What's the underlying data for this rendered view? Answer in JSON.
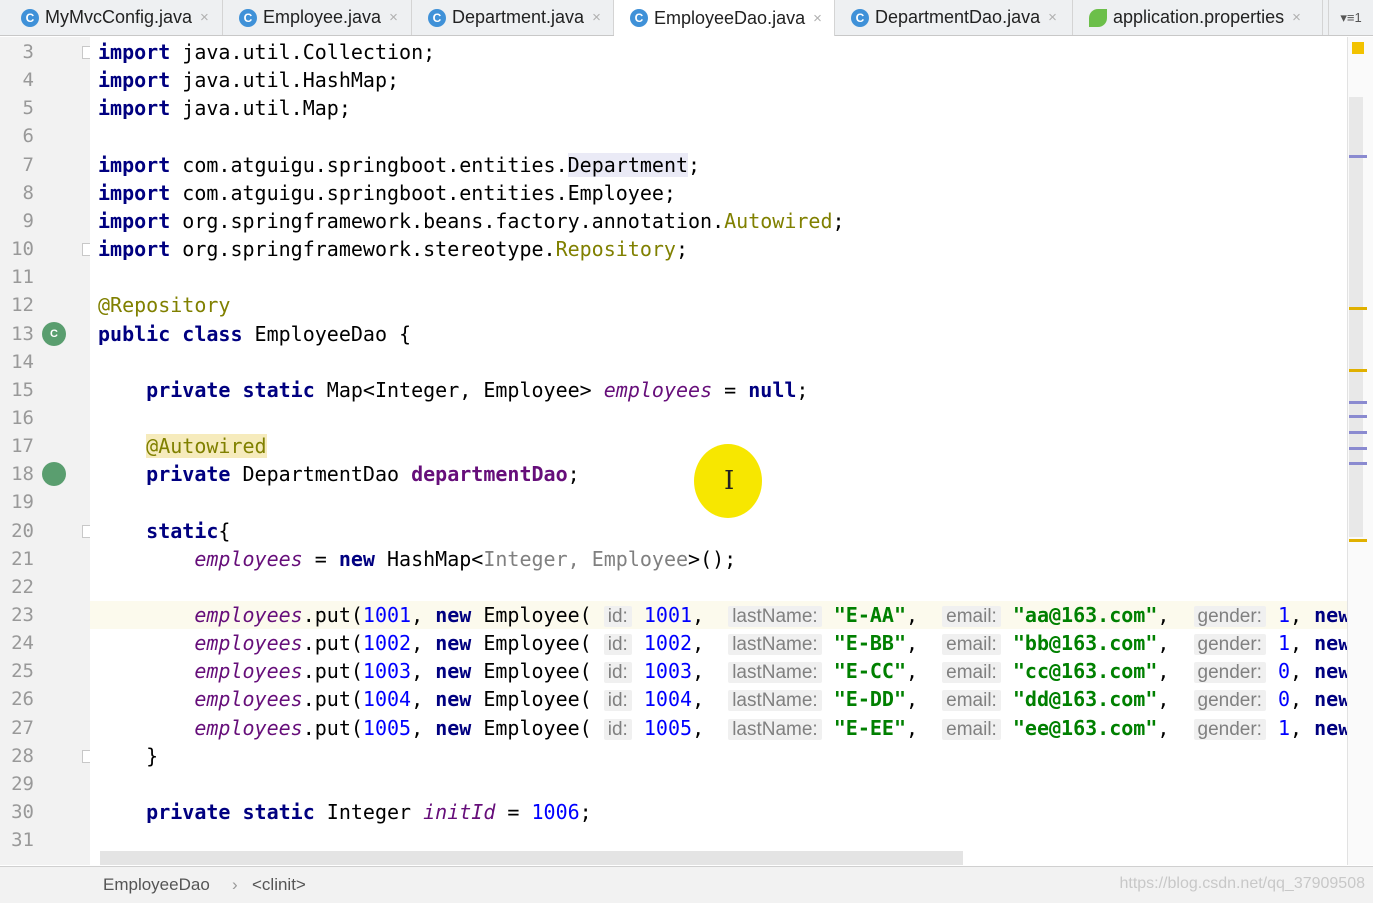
{
  "tabs": [
    {
      "label": "MyMvcConfig.java",
      "icon": "C",
      "active": false
    },
    {
      "label": "Employee.java",
      "icon": "C",
      "active": false
    },
    {
      "label": "Department.java",
      "icon": "C",
      "active": false
    },
    {
      "label": "EmployeeDao.java",
      "icon": "C",
      "active": true
    },
    {
      "label": "DepartmentDao.java",
      "icon": "C",
      "active": false
    },
    {
      "label": "application.properties",
      "icon": "leaf",
      "active": false
    }
  ],
  "tab_overflow": "▾≡1",
  "close_glyph": "×",
  "lines": [
    {
      "n": "3",
      "t": [
        [
          "kw",
          "import"
        ],
        [
          "",
          " java.util.Collection;"
        ]
      ]
    },
    {
      "n": "4",
      "t": [
        [
          "kw",
          "import"
        ],
        [
          "",
          " java.util.HashMap;"
        ]
      ]
    },
    {
      "n": "5",
      "t": [
        [
          "kw",
          "import"
        ],
        [
          "",
          " java.util.Map;"
        ]
      ]
    },
    {
      "n": "6",
      "t": []
    },
    {
      "n": "7",
      "t": [
        [
          "kw",
          "import"
        ],
        [
          "",
          " com.atguigu.springboot.entities."
        ],
        [
          "hl-type",
          "Department"
        ],
        [
          "",
          ";"
        ]
      ]
    },
    {
      "n": "8",
      "t": [
        [
          "kw",
          "import"
        ],
        [
          "",
          " com.atguigu.springboot.entities.Employee;"
        ]
      ]
    },
    {
      "n": "9",
      "t": [
        [
          "kw",
          "import"
        ],
        [
          "",
          " org.springframework.beans.factory.annotation."
        ],
        [
          "ann",
          "Autowired"
        ],
        [
          "",
          ";"
        ]
      ]
    },
    {
      "n": "10",
      "t": [
        [
          "kw",
          "import"
        ],
        [
          "",
          " org.springframework.stereotype."
        ],
        [
          "ann",
          "Repository"
        ],
        [
          "",
          ";"
        ]
      ]
    },
    {
      "n": "11",
      "t": []
    },
    {
      "n": "12",
      "t": [
        [
          "ann",
          "@Repository"
        ]
      ]
    },
    {
      "n": "13",
      "t": [
        [
          "kw",
          "public class"
        ],
        [
          "",
          " EmployeeDao {"
        ]
      ]
    },
    {
      "n": "14",
      "t": []
    },
    {
      "n": "15",
      "t": [
        [
          "",
          "    "
        ],
        [
          "kw",
          "private static"
        ],
        [
          "",
          " Map<Integer, Employee> "
        ],
        [
          "ital",
          "employees"
        ],
        [
          "",
          " = "
        ],
        [
          "kw",
          "null"
        ],
        [
          "",
          ";"
        ]
      ]
    },
    {
      "n": "16",
      "t": []
    },
    {
      "n": "17",
      "t": [
        [
          "",
          "    "
        ],
        [
          "ann hl-ann",
          "@Autowired"
        ]
      ]
    },
    {
      "n": "18",
      "t": [
        [
          "",
          "    "
        ],
        [
          "kw",
          "private"
        ],
        [
          "",
          " DepartmentDao "
        ],
        [
          "fld",
          "departmentDao"
        ],
        [
          "",
          ";"
        ]
      ]
    },
    {
      "n": "19",
      "t": []
    },
    {
      "n": "20",
      "t": [
        [
          "",
          "    "
        ],
        [
          "kw",
          "static"
        ],
        [
          "",
          "{"
        ]
      ]
    },
    {
      "n": "21",
      "t": [
        [
          "",
          "        "
        ],
        [
          "ital",
          "employees"
        ],
        [
          "",
          " = "
        ],
        [
          "kw",
          "new"
        ],
        [
          "",
          " HashMap<"
        ],
        [
          "gen",
          "Integer, Employee"
        ],
        [
          "",
          ">();"
        ]
      ]
    },
    {
      "n": "22",
      "t": []
    },
    {
      "n": "23",
      "t": [
        [
          "",
          "        "
        ],
        [
          "ital",
          "employees"
        ],
        [
          "",
          ".put("
        ],
        [
          "num",
          "1001"
        ],
        [
          "",
          ", "
        ],
        [
          "kw",
          "new"
        ],
        [
          "",
          " Employee( "
        ],
        [
          "hint",
          "id:"
        ],
        [
          "",
          " "
        ],
        [
          "num",
          "1001"
        ],
        [
          "",
          ",  "
        ],
        [
          "hint",
          "lastName:"
        ],
        [
          "",
          " "
        ],
        [
          "str",
          "\"E-AA\""
        ],
        [
          "",
          ",  "
        ],
        [
          "hint",
          "email:"
        ],
        [
          "",
          " "
        ],
        [
          "str",
          "\"aa@163.com\""
        ],
        [
          "",
          ",  "
        ],
        [
          "hint",
          "gender:"
        ],
        [
          "",
          " "
        ],
        [
          "num",
          "1"
        ],
        [
          "",
          ", "
        ],
        [
          "kw",
          "new"
        ]
      ]
    },
    {
      "n": "24",
      "t": [
        [
          "",
          "        "
        ],
        [
          "ital",
          "employees"
        ],
        [
          "",
          ".put("
        ],
        [
          "num",
          "1002"
        ],
        [
          "",
          ", "
        ],
        [
          "kw",
          "new"
        ],
        [
          "",
          " Employee( "
        ],
        [
          "hint",
          "id:"
        ],
        [
          "",
          " "
        ],
        [
          "num",
          "1002"
        ],
        [
          "",
          ",  "
        ],
        [
          "hint",
          "lastName:"
        ],
        [
          "",
          " "
        ],
        [
          "str",
          "\"E-BB\""
        ],
        [
          "",
          ",  "
        ],
        [
          "hint",
          "email:"
        ],
        [
          "",
          " "
        ],
        [
          "str",
          "\"bb@163.com\""
        ],
        [
          "",
          ",  "
        ],
        [
          "hint",
          "gender:"
        ],
        [
          "",
          " "
        ],
        [
          "num",
          "1"
        ],
        [
          "",
          ", "
        ],
        [
          "kw",
          "new"
        ]
      ]
    },
    {
      "n": "25",
      "t": [
        [
          "",
          "        "
        ],
        [
          "ital",
          "employees"
        ],
        [
          "",
          ".put("
        ],
        [
          "num",
          "1003"
        ],
        [
          "",
          ", "
        ],
        [
          "kw",
          "new"
        ],
        [
          "",
          " Employee( "
        ],
        [
          "hint",
          "id:"
        ],
        [
          "",
          " "
        ],
        [
          "num",
          "1003"
        ],
        [
          "",
          ",  "
        ],
        [
          "hint",
          "lastName:"
        ],
        [
          "",
          " "
        ],
        [
          "str",
          "\"E-CC\""
        ],
        [
          "",
          ",  "
        ],
        [
          "hint",
          "email:"
        ],
        [
          "",
          " "
        ],
        [
          "str",
          "\"cc@163.com\""
        ],
        [
          "",
          ",  "
        ],
        [
          "hint",
          "gender:"
        ],
        [
          "",
          " "
        ],
        [
          "num",
          "0"
        ],
        [
          "",
          ", "
        ],
        [
          "kw",
          "new"
        ]
      ]
    },
    {
      "n": "26",
      "t": [
        [
          "",
          "        "
        ],
        [
          "ital",
          "employees"
        ],
        [
          "",
          ".put("
        ],
        [
          "num",
          "1004"
        ],
        [
          "",
          ", "
        ],
        [
          "kw",
          "new"
        ],
        [
          "",
          " Employee( "
        ],
        [
          "hint",
          "id:"
        ],
        [
          "",
          " "
        ],
        [
          "num",
          "1004"
        ],
        [
          "",
          ",  "
        ],
        [
          "hint",
          "lastName:"
        ],
        [
          "",
          " "
        ],
        [
          "str",
          "\"E-DD\""
        ],
        [
          "",
          ",  "
        ],
        [
          "hint",
          "email:"
        ],
        [
          "",
          " "
        ],
        [
          "str",
          "\"dd@163.com\""
        ],
        [
          "",
          ",  "
        ],
        [
          "hint",
          "gender:"
        ],
        [
          "",
          " "
        ],
        [
          "num",
          "0"
        ],
        [
          "",
          ", "
        ],
        [
          "kw",
          "new"
        ]
      ]
    },
    {
      "n": "27",
      "t": [
        [
          "",
          "        "
        ],
        [
          "ital",
          "employees"
        ],
        [
          "",
          ".put("
        ],
        [
          "num",
          "1005"
        ],
        [
          "",
          ", "
        ],
        [
          "kw",
          "new"
        ],
        [
          "",
          " Employee( "
        ],
        [
          "hint",
          "id:"
        ],
        [
          "",
          " "
        ],
        [
          "num",
          "1005"
        ],
        [
          "",
          ",  "
        ],
        [
          "hint",
          "lastName:"
        ],
        [
          "",
          " "
        ],
        [
          "str",
          "\"E-EE\""
        ],
        [
          "",
          ",  "
        ],
        [
          "hint",
          "email:"
        ],
        [
          "",
          " "
        ],
        [
          "str",
          "\"ee@163.com\""
        ],
        [
          "",
          ",  "
        ],
        [
          "hint",
          "gender:"
        ],
        [
          "",
          " "
        ],
        [
          "num",
          "1"
        ],
        [
          "",
          ", "
        ],
        [
          "kw",
          "new"
        ]
      ]
    },
    {
      "n": "28",
      "t": [
        [
          "",
          "    }"
        ]
      ]
    },
    {
      "n": "29",
      "t": []
    },
    {
      "n": "30",
      "t": [
        [
          "",
          "    "
        ],
        [
          "kw",
          "private static"
        ],
        [
          "",
          " Integer "
        ],
        [
          "ital",
          "initId"
        ],
        [
          "",
          " = "
        ],
        [
          "num",
          "1006"
        ],
        [
          "",
          ";"
        ]
      ]
    },
    {
      "n": "31",
      "t": []
    }
  ],
  "current_line": "23",
  "gutter_icons": {
    "13": "C",
    "18": ""
  },
  "breadcrumb": {
    "class": "EmployeeDao",
    "separator": "›",
    "member": "<clinit>"
  },
  "watermark": "https://blog.csdn.net/qq_37909508",
  "colors": {
    "keyword": "#000080",
    "annotation": "#808000",
    "string": "#008000",
    "number": "#0000ff",
    "field": "#660e7a",
    "marker_warning": "#f2c200"
  }
}
